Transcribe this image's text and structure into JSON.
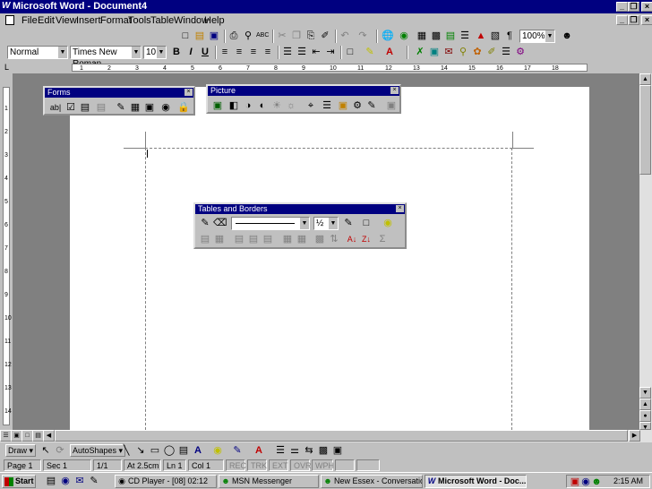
{
  "window": {
    "title": "Microsoft Word - Document4",
    "minimize": "_",
    "restore": "❐",
    "close": "×"
  },
  "menu": [
    "File",
    "Edit",
    "View",
    "Insert",
    "Format",
    "Tools",
    "Table",
    "Window",
    "Help"
  ],
  "formatting": {
    "style": "Normal",
    "font": "Times New Roman",
    "size": "10",
    "zoom": "100%"
  },
  "ruler_labels": [
    "1",
    "2",
    "3",
    "4",
    "5",
    "6",
    "7",
    "8",
    "9",
    "10",
    "11",
    "12",
    "13",
    "14",
    "15",
    "16",
    "17",
    "18"
  ],
  "vruler_labels": [
    "1",
    "2",
    "3",
    "4",
    "5",
    "6",
    "7",
    "8",
    "9",
    "10",
    "11",
    "12",
    "13",
    "14"
  ],
  "forms_toolbar": {
    "title": "Forms",
    "text_field": "ab|"
  },
  "picture_toolbar": {
    "title": "Picture"
  },
  "tables_toolbar": {
    "title": "Tables and Borders",
    "line_weight": "½"
  },
  "drawbar": {
    "draw": "Draw ▾",
    "autoshapes": "AutoShapes ▾"
  },
  "status": {
    "page": "Page 1",
    "sec": "Sec 1",
    "pos": "1/1",
    "at": "At 2.5cm",
    "ln": "Ln 1",
    "col": "Col 1",
    "rec": "REC",
    "trk": "TRK",
    "ext": "EXT",
    "ovr": "OVR",
    "wph": "WPH"
  },
  "taskbar": {
    "start": "Start",
    "tasks": [
      "CD Player - [08] 02:12",
      "MSN Messenger",
      "New Essex - Conversation",
      "Microsoft Word - Doc..."
    ],
    "clock": "2:15 AM"
  },
  "colors": {
    "titlebar": "#000080",
    "face": "#c0c0c0",
    "docbg": "#808080"
  }
}
